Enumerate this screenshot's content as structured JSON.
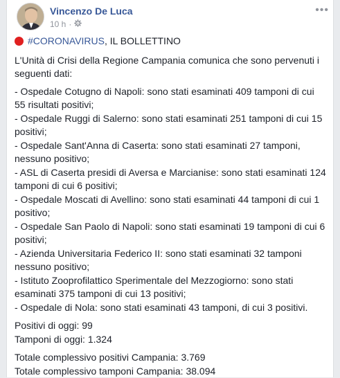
{
  "post": {
    "author": "Vincenzo De Luca",
    "time": "10 h",
    "more_label": "•••",
    "hashtag": "#CORONAVIRUS",
    "title_rest": ", IL BOLLETTINO",
    "intro": "L'Unità di Crisi della Regione Campania comunica che sono pervenuti i seguenti dati:",
    "items": [
      "- Ospedale Cotugno di Napoli: sono stati esaminati 409 tamponi di cui 55 risultati positivi;",
      "- Ospedale Ruggi di Salerno: sono stati esaminati 251 tamponi di cui 15 positivi;",
      "- Ospedale Sant'Anna di Caserta: sono stati esaminati 27 tamponi, nessuno positivo;",
      "- ASL di Caserta presidi di Aversa e Marcianise: sono stati esaminati 124 tamponi di cui 6 positivi;",
      "- Ospedale Moscati di Avellino: sono stati esaminati 44 tamponi di cui 1 positivo;",
      "- Ospedale San Paolo di Napoli: sono stati esaminati 19 tamponi di cui 6 positivi;",
      "- Azienda Universitaria Federico II: sono stati esaminati 32 tamponi nessuno positivo;",
      "- Istituto Zooprofilattico Sperimentale del Mezzogiorno: sono stati esaminati 375 tamponi di cui 13 positivi;",
      "- Ospedale di Nola: sono stati esaminati 43 tamponi, di cui 3 positivi."
    ],
    "positivi_oggi": "Positivi di oggi: 99",
    "tamponi_oggi": "Tamponi di oggi: 1.324",
    "totale_positivi": "Totale complessivo positivi Campania: 3.769",
    "totale_tamponi": "Totale complessivo tamponi Campania: 38.094"
  }
}
